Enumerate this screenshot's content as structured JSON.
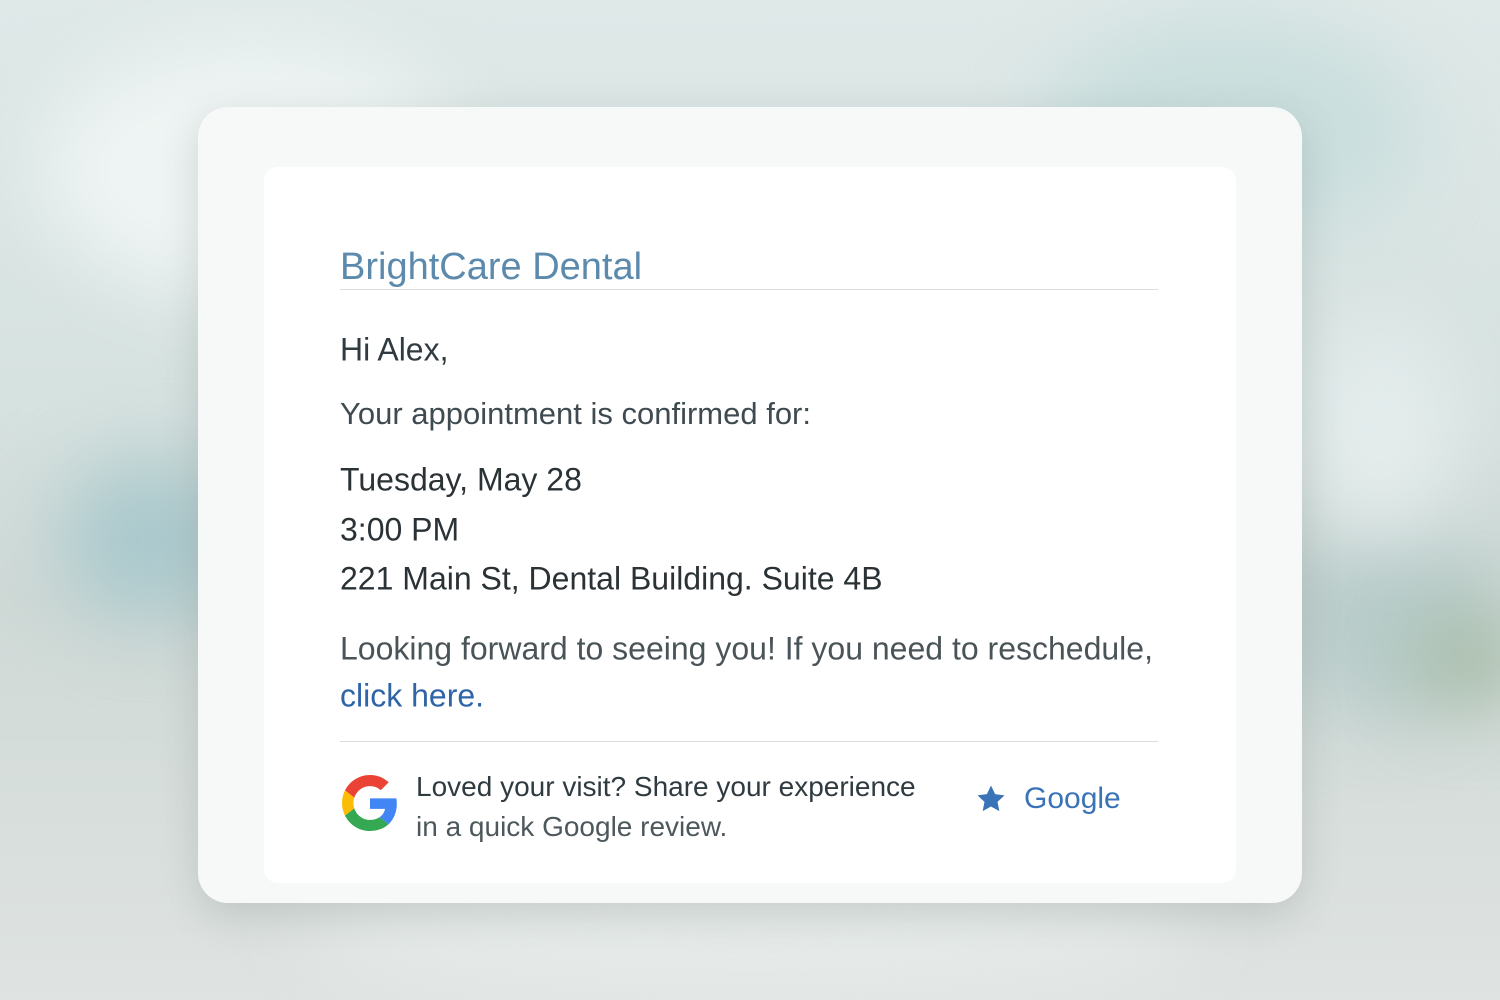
{
  "email": {
    "brand": "BrightCare Dental",
    "greeting": "Hi Alex,",
    "intro": "Your appointment is confirmed for:",
    "appointment": {
      "date": "Tuesday, May 28",
      "time": "3:00 PM",
      "address": "221 Main St, Dental Building. Suite 4B"
    },
    "closing": "Looking forward to seeing you! If you need to reschedule,",
    "reschedule_link": "click here.",
    "review": {
      "line1": "Loved your visit? Share your experience",
      "line2": "in a quick Google review.",
      "button_label": "Google",
      "logo_icon": "google-g-icon",
      "button_icon": "star-icon"
    }
  },
  "colors": {
    "brand": "#5b8aad",
    "link": "#2f64a6",
    "google_blue": "#4285F4",
    "google_red": "#EA4335",
    "google_yellow": "#FBBC05",
    "google_green": "#34A853"
  }
}
